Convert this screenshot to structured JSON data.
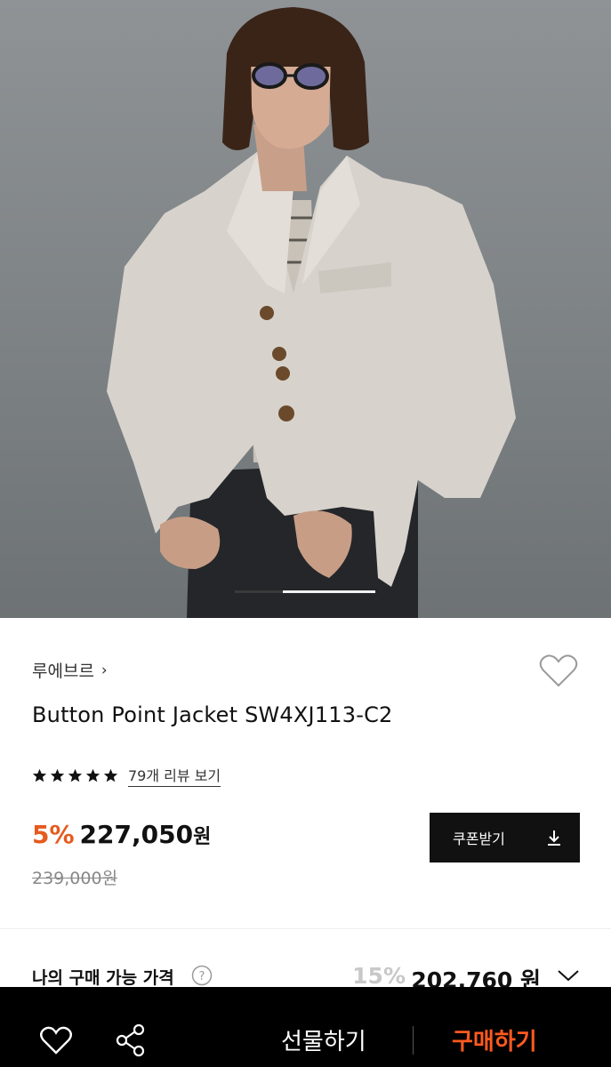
{
  "hero": {
    "image_description": "",
    "pager_active_index": 1,
    "pager_count": 3
  },
  "product": {
    "brand": "루에브르",
    "title": "Button Point Jacket SW4XJ113-C2",
    "rating_stars": 5,
    "review_link": "79개 리뷰 보기",
    "discount": "5%",
    "price": "227,050",
    "currency": "원",
    "original_price": "239,000원",
    "coupon_button": "쿠폰받기"
  },
  "my_price": {
    "label": "나의 구매 가능 가격",
    "discount": "15%",
    "price": "202,760",
    "currency": "원"
  },
  "bottom_bar": {
    "gift": "선물하기",
    "buy": "구매하기"
  },
  "colors": {
    "accent": "#e65a1e",
    "buy": "#ff5a1f",
    "bar": "#000000"
  },
  "icons": [
    "heart-icon",
    "star-icon",
    "download-icon",
    "help-icon",
    "chevron-down-icon",
    "share-icon"
  ]
}
